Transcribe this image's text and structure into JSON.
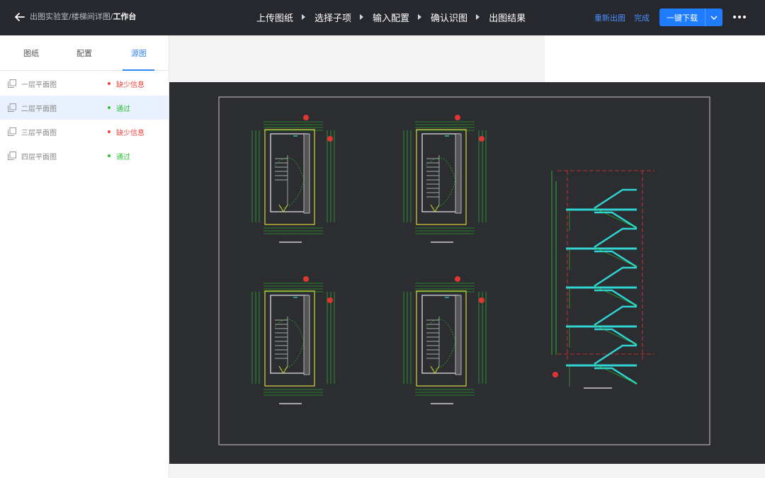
{
  "header": {
    "back_icon": "arrow-left-icon",
    "breadcrumb": {
      "items": [
        "出图实验室",
        "楼梯间详图"
      ],
      "separator": "/",
      "current": "工作台"
    },
    "steps": [
      "上传图纸",
      "选择子项",
      "输入配置",
      "确认识图",
      "出图结果"
    ],
    "redraw_label": "重新出图",
    "done_label": "完成",
    "download_label": "一键下载",
    "more_icon": "more-horizontal-icon"
  },
  "sidebar": {
    "tabs": [
      {
        "label": "图纸",
        "active": false
      },
      {
        "label": "配置",
        "active": false
      },
      {
        "label": "源图",
        "active": true
      }
    ],
    "files": [
      {
        "name": "一层平面图",
        "status": "缺少信息",
        "status_type": "missing",
        "selected": false
      },
      {
        "name": "二层平面图",
        "status": "通过",
        "status_type": "passed",
        "selected": true
      },
      {
        "name": "三层平面图",
        "status": "缺少信息",
        "status_type": "missing",
        "selected": false
      },
      {
        "name": "四层平面图",
        "status": "通过",
        "status_type": "passed",
        "selected": false
      }
    ]
  },
  "colors": {
    "topbar": "#26282d",
    "accent": "#1f7cff",
    "link": "#4c8dff",
    "missing": "#f04141",
    "passed": "#2fbf3a",
    "cad_background": "#2c2d31",
    "cad_green": "#27d327",
    "cad_yellow": "#d9d13a",
    "cad_cyan": "#2fd4d4",
    "cad_red": "#e03535"
  }
}
